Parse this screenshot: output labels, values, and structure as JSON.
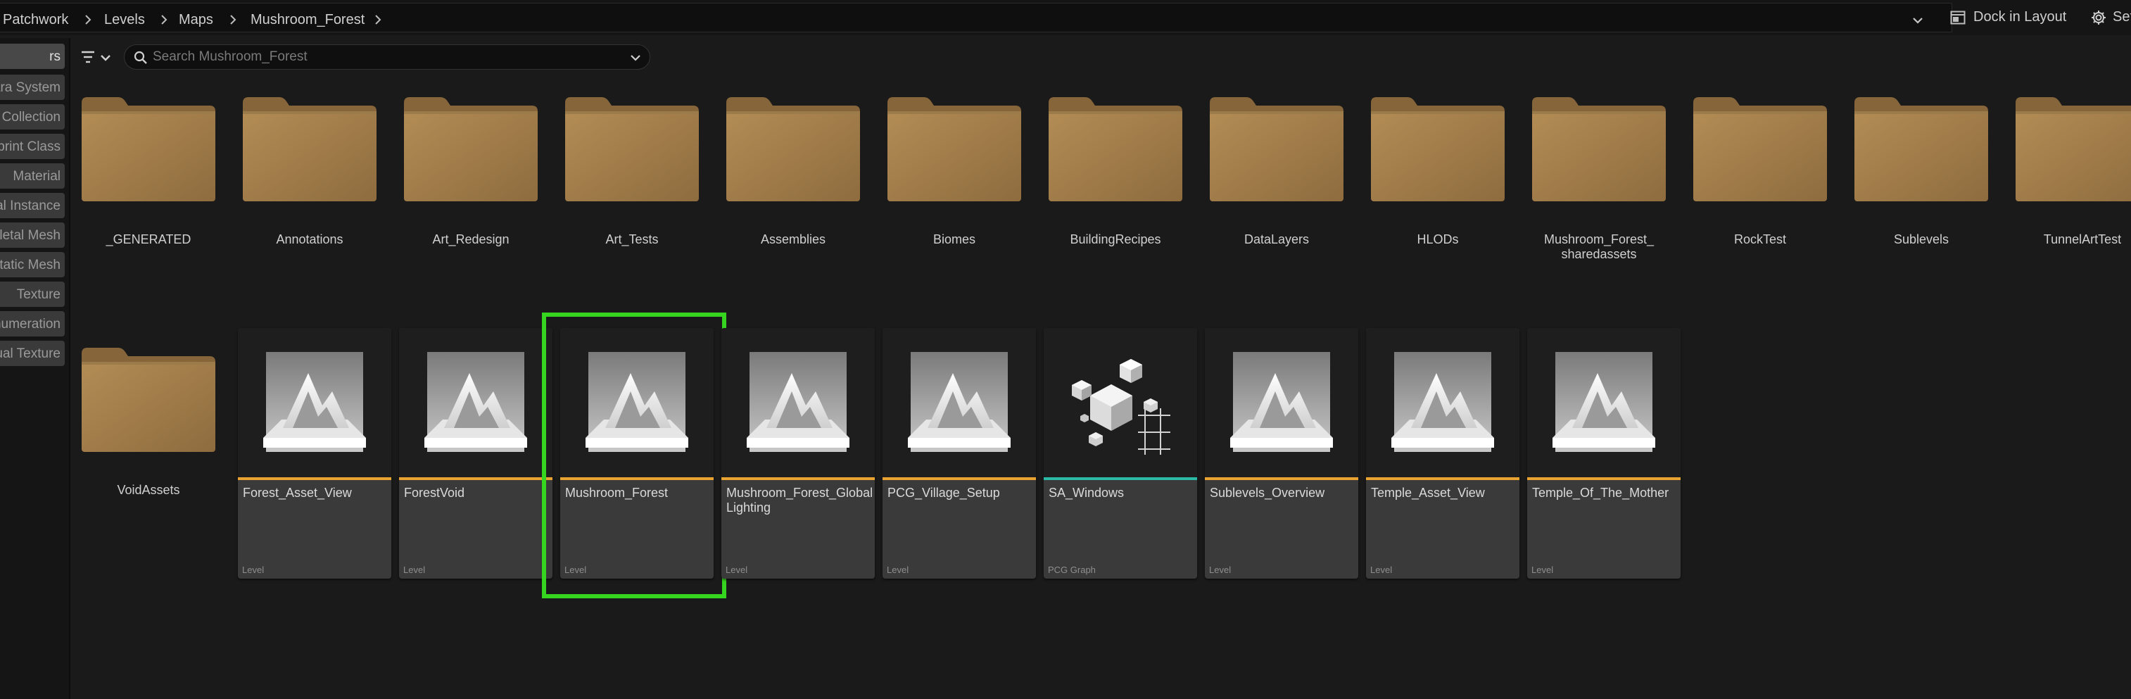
{
  "breadcrumb": {
    "items": [
      "Patchwork",
      "Levels",
      "Maps",
      "Mushroom_Forest"
    ],
    "dock_label": "Dock in Layout",
    "settings_label": "Settings"
  },
  "filters": {
    "header": "rs",
    "items": [
      "Niagara System",
      "Geometry Collection",
      "Blueprint Class",
      "Material",
      "Material Instance",
      "Skeletal Mesh",
      "Static Mesh",
      "Texture",
      "Enumeration",
      "Runtime Virtual Texture"
    ]
  },
  "search": {
    "placeholder": "Search Mushroom_Forest",
    "value": ""
  },
  "folders": [
    "_GENERATED",
    "Annotations",
    "Art_Redesign",
    "Art_Tests",
    "Assemblies",
    "Biomes",
    "BuildingRecipes",
    "DataLayers",
    "HLODs",
    "Mushroom_Forest_\nsharedassets",
    "RockTest",
    "Sublevels",
    "TunnelArtTest",
    "VoidAssets"
  ],
  "assets": [
    {
      "name": "Forest_Asset_View",
      "type": "Level",
      "icon": "level-icon",
      "accent": "#e8a330",
      "selected": false
    },
    {
      "name": "ForestVoid",
      "type": "Level",
      "icon": "level-icon",
      "accent": "#e8a330",
      "selected": false
    },
    {
      "name": "Mushroom_Forest",
      "type": "Level",
      "icon": "level-icon",
      "accent": "#e8a330",
      "selected": true
    },
    {
      "name": "Mushroom_Forest_Global\nLighting",
      "type": "Level",
      "icon": "level-icon",
      "accent": "#e8a330",
      "selected": false
    },
    {
      "name": "PCG_Village_Setup",
      "type": "Level",
      "icon": "level-icon",
      "accent": "#e8a330",
      "selected": false
    },
    {
      "name": "SA_Windows",
      "type": "PCG Graph",
      "icon": "pcg-graph-icon",
      "accent": "#2bb9a8",
      "selected": false
    },
    {
      "name": "Sublevels_Overview",
      "type": "Level",
      "icon": "level-icon",
      "accent": "#e8a330",
      "selected": false
    },
    {
      "name": "Temple_Asset_View",
      "type": "Level",
      "icon": "level-icon",
      "accent": "#e8a330",
      "selected": false
    },
    {
      "name": "Temple_Of_The_Mother",
      "type": "Level",
      "icon": "level-icon",
      "accent": "#e8a330",
      "selected": false
    }
  ],
  "colors": {
    "selection": "#36d51f",
    "level_accent": "#e8a330",
    "pcg_accent": "#2bb9a8"
  }
}
